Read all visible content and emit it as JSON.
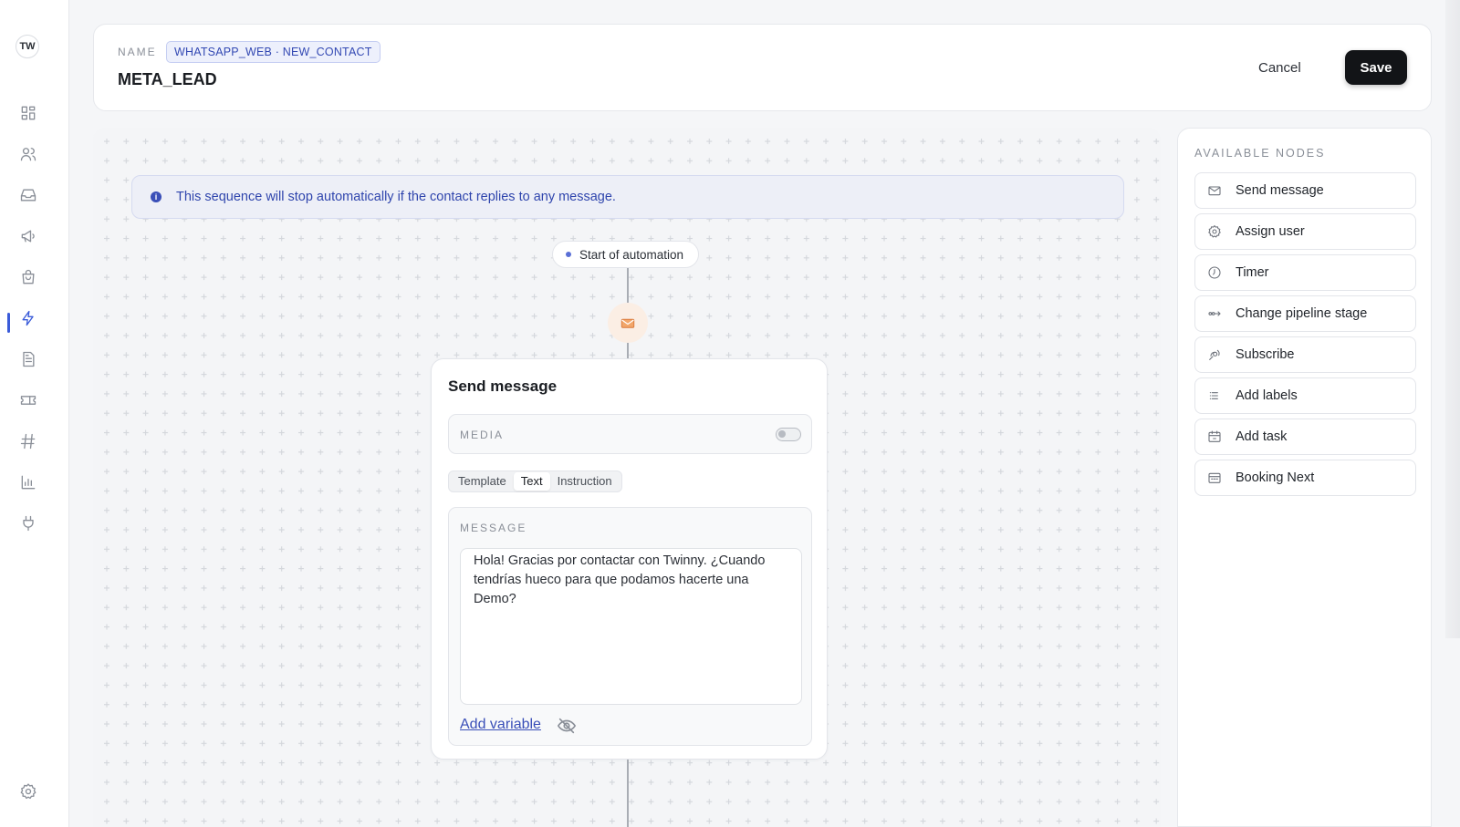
{
  "user": {
    "initials": "TW"
  },
  "nav": [
    {
      "name": "dashboard-icon"
    },
    {
      "name": "contacts-icon"
    },
    {
      "name": "inbox-icon"
    },
    {
      "name": "campaigns-icon"
    },
    {
      "name": "orders-icon"
    },
    {
      "name": "automations-icon",
      "active": true
    },
    {
      "name": "documents-icon"
    },
    {
      "name": "tickets-icon"
    },
    {
      "name": "channels-icon"
    },
    {
      "name": "reports-icon"
    },
    {
      "name": "integrations-icon"
    },
    {
      "name": "settings-icon"
    }
  ],
  "header": {
    "name_label": "NAME",
    "trigger_badge": "WHATSAPP_WEB · NEW_CONTACT",
    "title": "META_LEAD",
    "cancel_label": "Cancel",
    "save_label": "Save"
  },
  "canvas": {
    "info_text": "This sequence will stop automatically if the contact replies to any message.",
    "start_label": "Start of automation",
    "node": {
      "title": "Send message",
      "media_label": "MEDIA",
      "media_enabled": false,
      "tabs": [
        {
          "label": "Template",
          "selected": false
        },
        {
          "label": "Text",
          "selected": true
        },
        {
          "label": "Instruction",
          "selected": false
        }
      ],
      "message_label": "MESSAGE",
      "message_text": "Hola! Gracias por contactar con Twinny. ¿Cuando tendrías hueco para que podamos hacerte una Demo?",
      "add_variable_label": "Add variable"
    }
  },
  "panel": {
    "title": "AVAILABLE NODES",
    "items": [
      {
        "label": "Send message",
        "icon": "mail-icon"
      },
      {
        "label": "Assign user",
        "icon": "gear-icon"
      },
      {
        "label": "Timer",
        "icon": "clock-icon"
      },
      {
        "label": "Change pipeline stage",
        "icon": "pipeline-icon"
      },
      {
        "label": "Subscribe",
        "icon": "subscribe-icon"
      },
      {
        "label": "Add labels",
        "icon": "labels-icon"
      },
      {
        "label": "Add task",
        "icon": "task-icon"
      },
      {
        "label": "Booking Next",
        "icon": "calendar-icon"
      }
    ]
  },
  "colors": {
    "accent": "#3a5bd9",
    "info_text": "#2f45ad",
    "save_button": "#121417",
    "mail_bubble": "#fbeee4"
  }
}
